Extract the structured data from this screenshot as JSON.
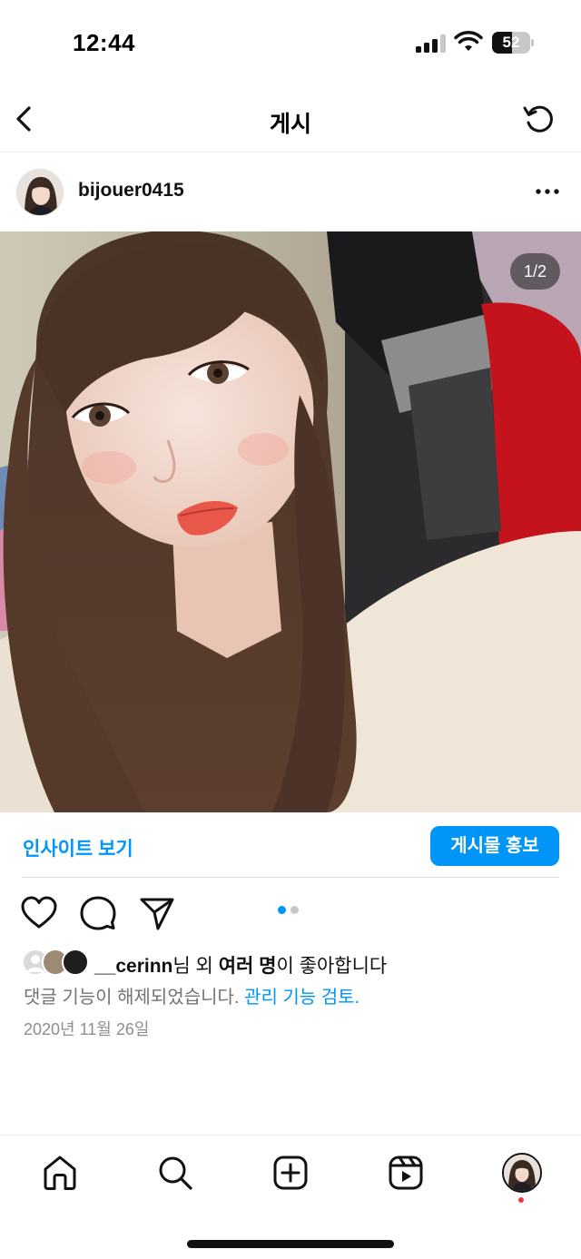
{
  "status_bar": {
    "time": "12:44",
    "battery_level": "52",
    "battery_fraction": 0.52,
    "signal_icon": "cellular-signal-icon",
    "wifi_icon": "wifi-icon"
  },
  "header": {
    "title": "게시",
    "back_icon": "chevron-left-icon",
    "refresh_icon": "refresh-icon"
  },
  "post": {
    "username": "bijouer0415",
    "more_icon": "more-horizontal-icon",
    "page_counter": "1/2",
    "carousel_pages": 2,
    "current_page": 1,
    "insights_label": "인사이트 보기",
    "boost_label": "게시물 홍보",
    "likes_user": "__cerinn",
    "likes_suffix_1": "님 외 ",
    "likes_others": "여러 명",
    "likes_suffix_2": "이 좋아합니다",
    "comments_disabled": "댓글 기능이 해제되었습니다.",
    "manage_link": "관리 기능 검토.",
    "date": "2020년 11월 26일"
  },
  "actions": {
    "like_icon": "heart-icon",
    "comment_icon": "comment-icon",
    "share_icon": "send-icon"
  },
  "tab_bar": {
    "items": [
      "home-icon",
      "search-icon",
      "add-post-icon",
      "reels-icon",
      "profile-avatar"
    ]
  },
  "colors": {
    "accent": "#0095f6",
    "notification": "#ff3040",
    "dot_active": "#0095f6",
    "dot_inactive": "#c7c7c7"
  }
}
